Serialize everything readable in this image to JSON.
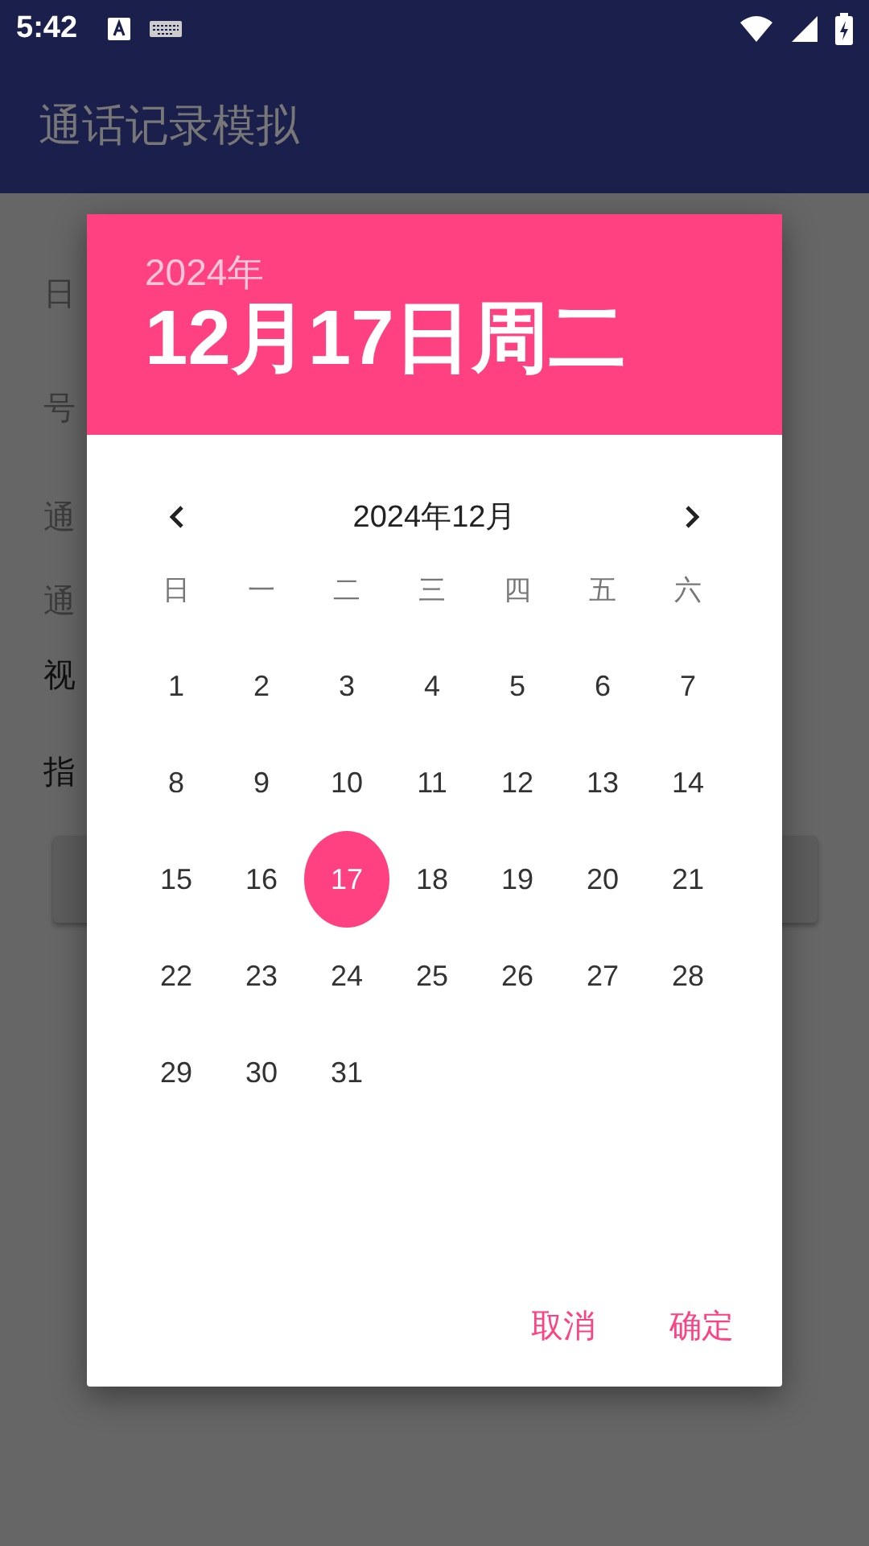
{
  "status_bar": {
    "time": "5:42"
  },
  "app_bar": {
    "title": "通话记录模拟"
  },
  "form": {
    "labels": [
      {
        "text": "日",
        "kind": "muted"
      },
      {
        "text": "号",
        "kind": "muted"
      },
      {
        "text": "通",
        "kind": "muted"
      },
      {
        "text": "通",
        "kind": "muted"
      },
      {
        "text": "视",
        "kind": "strong"
      },
      {
        "text": "指",
        "kind": "strong"
      }
    ]
  },
  "date_picker": {
    "year": "2024年",
    "date": "12月17日周二",
    "month_label": "2024年12月",
    "weekdays": [
      "日",
      "一",
      "二",
      "三",
      "四",
      "五",
      "六"
    ],
    "weeks": [
      [
        {
          "label": "1",
          "selected": false
        },
        {
          "label": "2",
          "selected": false
        },
        {
          "label": "3",
          "selected": false
        },
        {
          "label": "4",
          "selected": false
        },
        {
          "label": "5",
          "selected": false
        },
        {
          "label": "6",
          "selected": false
        },
        {
          "label": "7",
          "selected": false
        }
      ],
      [
        {
          "label": "8",
          "selected": false
        },
        {
          "label": "9",
          "selected": false
        },
        {
          "label": "10",
          "selected": false
        },
        {
          "label": "11",
          "selected": false
        },
        {
          "label": "12",
          "selected": false
        },
        {
          "label": "13",
          "selected": false
        },
        {
          "label": "14",
          "selected": false
        }
      ],
      [
        {
          "label": "15",
          "selected": false
        },
        {
          "label": "16",
          "selected": false
        },
        {
          "label": "17",
          "selected": true
        },
        {
          "label": "18",
          "selected": false
        },
        {
          "label": "19",
          "selected": false
        },
        {
          "label": "20",
          "selected": false
        },
        {
          "label": "21",
          "selected": false
        }
      ],
      [
        {
          "label": "22",
          "selected": false
        },
        {
          "label": "23",
          "selected": false
        },
        {
          "label": "24",
          "selected": false
        },
        {
          "label": "25",
          "selected": false
        },
        {
          "label": "26",
          "selected": false
        },
        {
          "label": "27",
          "selected": false
        },
        {
          "label": "28",
          "selected": false
        }
      ],
      [
        {
          "label": "29",
          "selected": false
        },
        {
          "label": "30",
          "selected": false
        },
        {
          "label": "31",
          "selected": false
        }
      ]
    ],
    "buttons": [
      "取消",
      "确定"
    ]
  }
}
